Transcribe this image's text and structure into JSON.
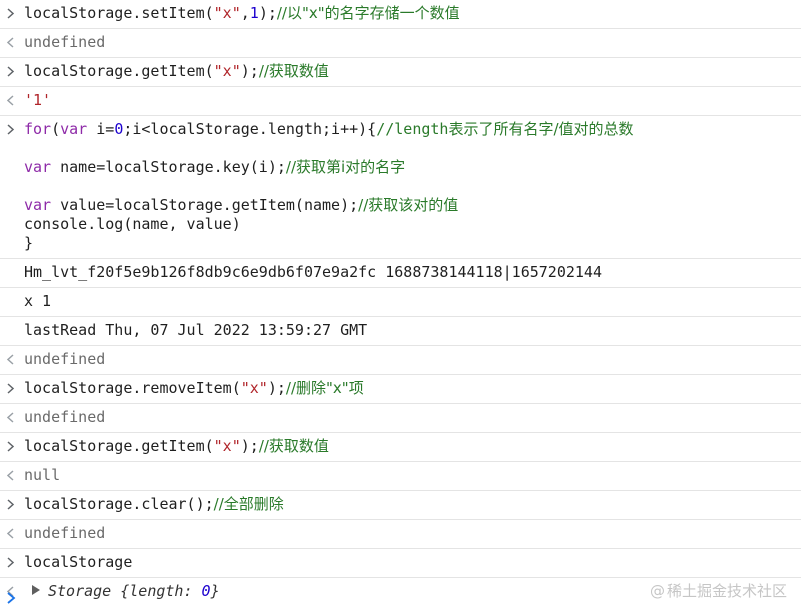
{
  "entries": [
    {
      "type": "input",
      "segments": [
        [
          "plain",
          "localStorage.setItem("
        ],
        [
          "str",
          "\"x\""
        ],
        [
          "plain",
          ","
        ],
        [
          "num",
          "1"
        ],
        [
          "plain",
          ");"
        ],
        [
          "cm",
          "//以\"x\"的名字存储一个数值"
        ]
      ]
    },
    {
      "type": "output",
      "text": "undefined",
      "style": "undef"
    },
    {
      "type": "input",
      "segments": [
        [
          "plain",
          "localStorage.getItem("
        ],
        [
          "str",
          "\"x\""
        ],
        [
          "plain",
          ");"
        ],
        [
          "cm",
          "//获取数值"
        ]
      ]
    },
    {
      "type": "output",
      "text": "'1'",
      "style": "str"
    },
    {
      "type": "input-multi",
      "lines": [
        [
          [
            "kw",
            "for"
          ],
          [
            "plain",
            "("
          ],
          [
            "kw",
            "var"
          ],
          [
            "plain",
            " i="
          ],
          [
            "num",
            "0"
          ],
          [
            "plain",
            ";i<localStorage.length;i++){"
          ],
          [
            "cmm",
            "//length"
          ],
          [
            "cm",
            "表示了所有名字/值对的总数"
          ]
        ],
        [],
        [
          [
            "kw",
            "var"
          ],
          [
            "plain",
            " name=localStorage.key(i);"
          ],
          [
            "cm",
            "//获取第i对的名字"
          ]
        ],
        [],
        [
          [
            "kw",
            "var"
          ],
          [
            "plain",
            " value=localStorage.getItem(name);"
          ],
          [
            "cm",
            "//获取该对的值"
          ]
        ],
        [
          [
            "plain",
            "console.log(name, value)"
          ]
        ],
        [
          [
            "plain",
            "}"
          ]
        ]
      ]
    },
    {
      "type": "log",
      "text": "Hm_lvt_f20f5e9b126f8db9c6e9db6f07e9a2fc 1688738144118|1657202144"
    },
    {
      "type": "log",
      "text": "x 1"
    },
    {
      "type": "log",
      "text": "lastRead Thu, 07 Jul 2022 13:59:27 GMT"
    },
    {
      "type": "output",
      "text": "undefined",
      "style": "undef"
    },
    {
      "type": "input",
      "segments": [
        [
          "plain",
          "localStorage.removeItem("
        ],
        [
          "str",
          "\"x\""
        ],
        [
          "plain",
          ");"
        ],
        [
          "cm",
          "//删除\"x\"项"
        ]
      ]
    },
    {
      "type": "output",
      "text": "undefined",
      "style": "undef"
    },
    {
      "type": "input",
      "segments": [
        [
          "plain",
          "localStorage.getItem("
        ],
        [
          "str",
          "\"x\""
        ],
        [
          "plain",
          ");"
        ],
        [
          "cm",
          "//获取数值"
        ]
      ]
    },
    {
      "type": "output",
      "text": "null",
      "style": "undef"
    },
    {
      "type": "input",
      "segments": [
        [
          "plain",
          "localStorage.clear();"
        ],
        [
          "cm",
          "//全部删除"
        ]
      ]
    },
    {
      "type": "output",
      "text": "undefined",
      "style": "undef"
    },
    {
      "type": "input",
      "segments": [
        [
          "plain",
          "localStorage"
        ]
      ]
    },
    {
      "type": "object",
      "label": "Storage",
      "body_open": " {length: ",
      "body_value": "0",
      "body_close": "}"
    }
  ],
  "watermark": {
    "at": "@",
    "text": "稀土掘金技术社区"
  },
  "colors": {
    "keyword": "#8e2aa8",
    "string": "#b0252a",
    "number": "#1c00cf",
    "comment": "#2a7a2a",
    "prompt_active": "#1a73e8"
  }
}
